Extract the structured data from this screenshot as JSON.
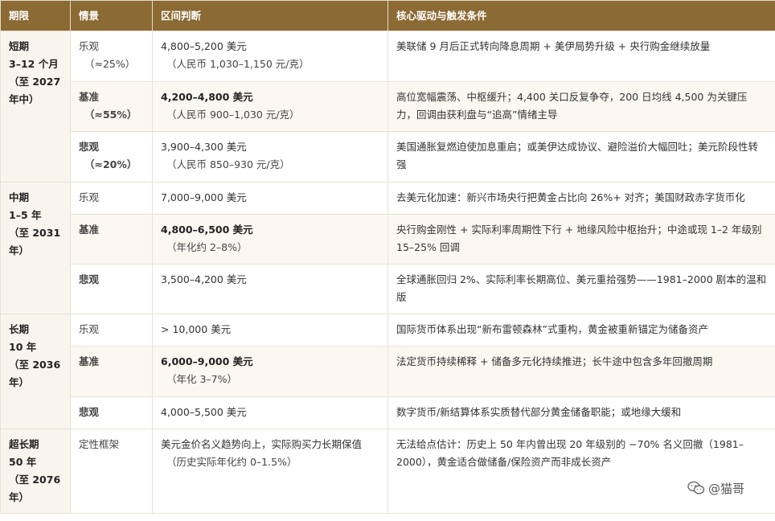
{
  "headers": [
    "期限",
    "情景",
    "区间判断",
    "核心驱动与触发条件"
  ],
  "periods": [
    {
      "line1": "短期",
      "line2": "3–12 个月",
      "line3": "（至 2027",
      "line4": "年中）"
    },
    {
      "line1": "中期",
      "line2": "1–5 年",
      "line3": "（至 2031",
      "line4": "年）"
    },
    {
      "line1": "长期",
      "line2": "10 年",
      "line3": "（至 2036",
      "line4": "年）"
    },
    {
      "line1": "超长期",
      "line2": "50 年",
      "line3": "（至 2076",
      "line4": "年）"
    }
  ],
  "rows": [
    {
      "scenario": "乐观",
      "scenario_sub": "（≈25%）",
      "range": "4,800–5,200 美元",
      "range_sub": "（人民币 1,030–1,150 元/克）",
      "driver": "美联储 9 月后正式转向降息周期 + 美伊局势升级 + 央行购金继续放量"
    },
    {
      "scenario": "基准",
      "scenario_sub": "（≈55%）",
      "range": "4,200–4,800 美元",
      "range_sub": "（人民币 900–1,030 元/克）",
      "driver": "高位宽幅震荡、中枢缓升；4,400 关口反复争夺，200 日均线 4,500 为关键压力，回调由获利盘与“追高”情绪主导"
    },
    {
      "scenario": "悲观",
      "scenario_sub": "（≈20%）",
      "range": "3,900–4,300 美元",
      "range_sub": "（人民币 850–930 元/克）",
      "driver": "美国通胀复燃迫使加息重启；或美伊达成协议、避险溢价大幅回吐；美元阶段性转强"
    },
    {
      "scenario": "乐观",
      "range": "7,000–9,000 美元",
      "driver": "去美元化加速：新兴市场央行把黄金占比向 26%+ 对齐；美国财政赤字货币化"
    },
    {
      "scenario": "基准",
      "range": "4,800–6,500 美元",
      "range_sub": "（年化约 2–8%）",
      "driver": "央行购金刚性 + 实际利率周期性下行 + 地缘风险中枢抬升；中途或现 1–2 年级别 15–25% 回调"
    },
    {
      "scenario": "悲观",
      "range": "3,500–4,200 美元",
      "driver": "全球通胀回归 2%、实际利率长期高位、美元重拾强势——1981–2000 剧本的温和版"
    },
    {
      "scenario": "乐观",
      "range": "> 10,000 美元",
      "driver": "国际货币体系出现“新布雷顿森林”式重构，黄金被重新锚定为储备资产"
    },
    {
      "scenario": "基准",
      "range": "6,000–9,000 美元",
      "range_sub": "（年化 3–7%）",
      "driver": "法定货币持续稀释 + 储备多元化持续推进；长牛途中包含多年回撤周期"
    },
    {
      "scenario": "悲观",
      "range": "4,000–5,500 美元",
      "driver": "数字货币/新结算体系实质替代部分黄金储备职能；或地缘大缓和"
    },
    {
      "scenario": "定性框架",
      "range": "美元金价名义趋势向上，实际购买力长期保值",
      "range_sub": "（历史实际年化约 0–1.5%）",
      "driver": "无法给点估计：历史上 50 年内曾出现 20 年级别的 −70% 名义回撤（1981–2000），黄金适合做储备/保险资产而非成长资产"
    }
  ],
  "watermark": {
    "icon": "wechat-icon",
    "text": "@猫哥"
  }
}
